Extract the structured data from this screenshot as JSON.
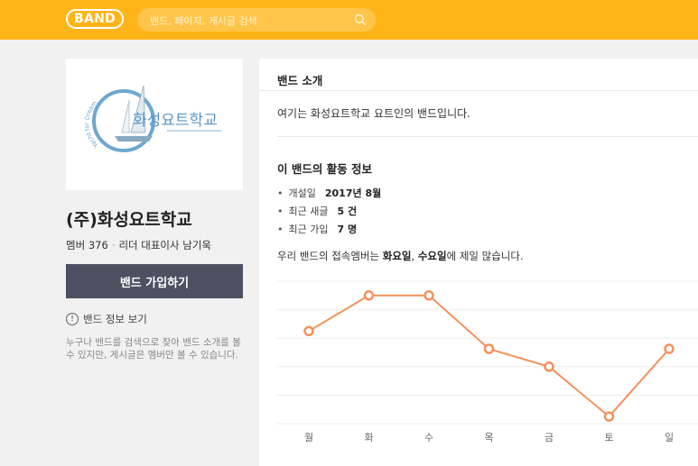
{
  "header": {
    "logo": "BAND",
    "search_placeholder": "밴드, 페이지, 게시글 검색"
  },
  "band": {
    "name": "(주)화성요트학교",
    "members_label": "멤버",
    "member_count": "376",
    "leader_label": "리더",
    "leader_name": "대표이사 남기욱",
    "join_label": "밴드 가입하기",
    "info_label": "밴드 정보 보기",
    "description": "누구나 밴드를 검색으로 찾아 밴드 소개를 볼 수 있지만, 게시글은 멤버만 볼 수 있습니다.",
    "cover": {
      "brand_text": "화성요트학교",
      "arc_text": "Yacht for Dream"
    }
  },
  "intro": {
    "title": "밴드 소개",
    "text": "여기는 화성요트학교 요트인의 밴드입니다."
  },
  "activity": {
    "title": "이 밴드의 활동 정보",
    "items": [
      {
        "label": "개설일",
        "value": "2017년 8월"
      },
      {
        "label": "최근 새글",
        "value": "5 건"
      },
      {
        "label": "최근 가입",
        "value": "7 명"
      }
    ],
    "summary_prefix": "우리 밴드의 접속멤버는 ",
    "summary_day1": "화요일",
    "summary_sep": ", ",
    "summary_day2": "수요일",
    "summary_suffix": "에 제일 많습니다."
  },
  "colors": {
    "header": "#ffb518",
    "line": "#f5915a",
    "join_button": "#4c5060"
  },
  "chart_data": {
    "type": "line",
    "categories": [
      "월",
      "화",
      "수",
      "목",
      "금",
      "토",
      "일"
    ],
    "values": [
      4.5,
      7,
      7,
      3.25,
      2,
      -1.5,
      3.25
    ],
    "ylim": [
      -2,
      8
    ],
    "grid": true,
    "legend": "none"
  }
}
